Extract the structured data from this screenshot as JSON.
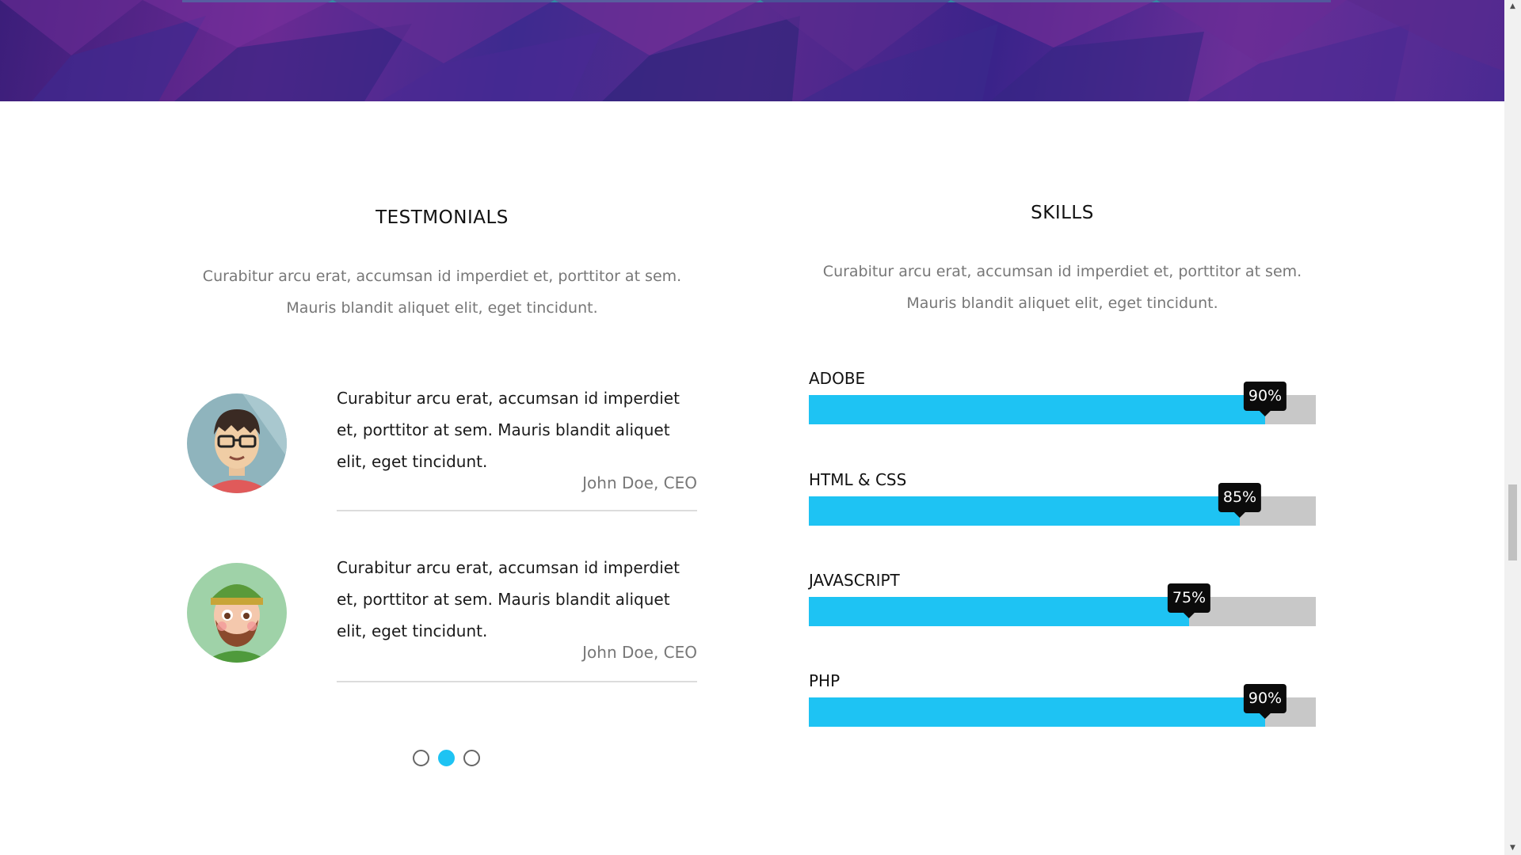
{
  "testimonials": {
    "title": "TESTMONIALS",
    "intro_line1": "Curabitur arcu erat, accumsan id imperdiet et, porttitor at sem.",
    "intro_line2": "Mauris blandit aliquet elit, eget tincidunt.",
    "items": [
      {
        "quote": "Curabitur arcu erat, accumsan id imperdiet et, porttitor at sem. Mauris blandit aliquet elit, eget tincidunt.",
        "author": "John Doe, CEO",
        "avatar_icon": "man-with-glasses-avatar"
      },
      {
        "quote": "Curabitur arcu erat, accumsan id imperdiet et, porttitor at sem. Mauris blandit aliquet elit, eget tincidunt.",
        "author": "John Doe, CEO",
        "avatar_icon": "bearded-man-with-hat-avatar"
      }
    ],
    "pagination": {
      "count": 3,
      "active_index": 1
    }
  },
  "skills": {
    "title": "SKILLS",
    "intro_line1": "Curabitur arcu erat, accumsan id imperdiet et, porttitor at sem.",
    "intro_line2": "Mauris blandit aliquet elit, eget tincidunt.",
    "items": [
      {
        "name": "ADOBE",
        "percent_label": "90%",
        "level": 90
      },
      {
        "name": "HTML & CSS",
        "percent_label": "85%",
        "level": 85
      },
      {
        "name": "JAVASCRIPT",
        "percent_label": "75%",
        "level": 75
      },
      {
        "name": "PHP",
        "percent_label": "90%",
        "level": 90
      }
    ]
  },
  "colors": {
    "accent": "#1ec3f3",
    "bar_track": "#c8c8c8",
    "badge": "#0b0b0b",
    "hero_purple": "#5a2a8e"
  }
}
